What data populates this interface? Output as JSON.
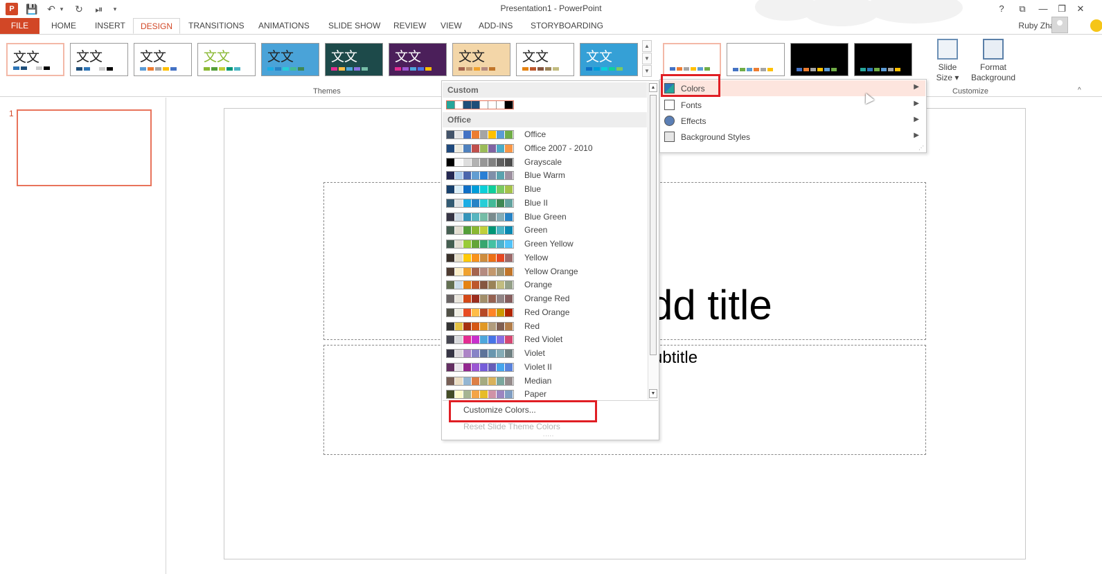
{
  "window": {
    "title": "Presentation1 - PowerPoint",
    "help": "?",
    "ribbon_display": "⧉",
    "minimize": "—",
    "restore": "❐",
    "close": "✕"
  },
  "qat": {
    "app_icon": "P",
    "save": "💾",
    "undo": "↶",
    "undo_more": "▾",
    "redo": "↻",
    "present": "⏯",
    "customize": "▾"
  },
  "tabs": {
    "file": "FILE",
    "home": "HOME",
    "insert": "INSERT",
    "design": "DESIGN",
    "transitions": "TRANSITIONS",
    "animations": "ANIMATIONS",
    "slideshow": "SLIDE SHOW",
    "review": "REVIEW",
    "view": "VIEW",
    "addins": "ADD-INS",
    "storyboarding": "STORYBOARDING"
  },
  "user": {
    "name": "Ruby Zhao",
    "menu_caret": "▾"
  },
  "ribbon": {
    "themes_glyph": "文文",
    "themes_label": "Themes",
    "customize_label": "Customize",
    "slide_size_1": "Slide",
    "slide_size_2": "Size ▾",
    "format_bg_1": "Format",
    "format_bg_2": "Background",
    "scroll_up": "▲",
    "scroll_down": "▼",
    "scroll_more": "▼"
  },
  "slides_pane": {
    "slide_number": "1"
  },
  "slide": {
    "title_placeholder": "Click to add title",
    "subtitle_placeholder": "Click to add subtitle"
  },
  "colors_menu": {
    "custom_header": "Custom",
    "office_header": "Office",
    "custom_swatch": [
      "#26a69a",
      "#ffffff",
      "#1f4e79",
      "#1f4e79",
      "#ffffff",
      "#ffffff",
      "#ffffff",
      "#000000"
    ],
    "palettes": [
      {
        "name": "Office",
        "colors": [
          "#44546a",
          "#e7e6e6",
          "#4472c4",
          "#ed7d31",
          "#a5a5a5",
          "#ffc000",
          "#5b9bd5",
          "#70ad47"
        ]
      },
      {
        "name": "Office 2007 - 2010",
        "colors": [
          "#1f497d",
          "#eeece1",
          "#4f81bd",
          "#c0504d",
          "#9bbb59",
          "#8064a2",
          "#4bacc6",
          "#f79646"
        ]
      },
      {
        "name": "Grayscale",
        "colors": [
          "#000000",
          "#f8f8f8",
          "#dddddd",
          "#b2b2b2",
          "#969696",
          "#808080",
          "#5f5f5f",
          "#4d4d4d"
        ]
      },
      {
        "name": "Blue Warm",
        "colors": [
          "#242852",
          "#acccea",
          "#4a66ac",
          "#629dd1",
          "#297fd5",
          "#7f8fa9",
          "#5aa2ae",
          "#9d90a0"
        ]
      },
      {
        "name": "Blue",
        "colors": [
          "#17406d",
          "#dbeff9",
          "#0f6fc6",
          "#009dd9",
          "#0bd0d9",
          "#10cf9b",
          "#7cca62",
          "#a5c249"
        ]
      },
      {
        "name": "Blue II",
        "colors": [
          "#335b74",
          "#dfe3e5",
          "#1cade4",
          "#2683c6",
          "#27ced7",
          "#42ba97",
          "#3e8853",
          "#62a39f"
        ]
      },
      {
        "name": "Blue Green",
        "colors": [
          "#373545",
          "#cedbe6",
          "#3494ba",
          "#58b6c0",
          "#75bda7",
          "#7a8c8e",
          "#84acb6",
          "#2683c6"
        ]
      },
      {
        "name": "Green",
        "colors": [
          "#455f51",
          "#e3ded1",
          "#549e39",
          "#8ab833",
          "#c0cf3a",
          "#029676",
          "#4ab5c4",
          "#0989b1"
        ]
      },
      {
        "name": "Green Yellow",
        "colors": [
          "#455f51",
          "#e3ded1",
          "#99cb38",
          "#63a537",
          "#37a76f",
          "#44c1a3",
          "#4eb3cf",
          "#51c3f9"
        ]
      },
      {
        "name": "Yellow",
        "colors": [
          "#39302a",
          "#e5dec9",
          "#ffca08",
          "#f8931d",
          "#ce8d3e",
          "#ec7016",
          "#e64823",
          "#9c6a6a"
        ]
      },
      {
        "name": "Yellow Orange",
        "colors": [
          "#4e3b30",
          "#fbeec9",
          "#f0a22e",
          "#a5644e",
          "#b58b80",
          "#c3986d",
          "#a19574",
          "#c17529"
        ]
      },
      {
        "name": "Orange",
        "colors": [
          "#637052",
          "#ccddea",
          "#e48312",
          "#bd582c",
          "#865640",
          "#9b8357",
          "#c2bc80",
          "#94a088"
        ]
      },
      {
        "name": "Orange Red",
        "colors": [
          "#696464",
          "#e9e5dc",
          "#d34817",
          "#9b2d1f",
          "#a28e6a",
          "#956251",
          "#918485",
          "#855d5d"
        ]
      },
      {
        "name": "Red Orange",
        "colors": [
          "#505046",
          "#eeece1",
          "#e84c22",
          "#ffbd47",
          "#b64926",
          "#ff8427",
          "#cc9900",
          "#b22600"
        ]
      },
      {
        "name": "Red",
        "colors": [
          "#323232",
          "#e5c243",
          "#a5300f",
          "#d55816",
          "#e19825",
          "#b19c7d",
          "#7f5f52",
          "#b27d49"
        ]
      },
      {
        "name": "Red Violet",
        "colors": [
          "#454551",
          "#d8d9dc",
          "#e32d91",
          "#c830cc",
          "#4ea6dc",
          "#4775e7",
          "#8971e1",
          "#d54773"
        ]
      },
      {
        "name": "Violet",
        "colors": [
          "#373545",
          "#dcd8dc",
          "#ad84c6",
          "#8784c7",
          "#5d739a",
          "#6997af",
          "#84acb6",
          "#6f8183"
        ]
      },
      {
        "name": "Violet II",
        "colors": [
          "#632e62",
          "#eae5eb",
          "#92278f",
          "#9b57d3",
          "#755dd9",
          "#665eb8",
          "#45a5ed",
          "#5982db"
        ]
      },
      {
        "name": "Median",
        "colors": [
          "#775f55",
          "#ebddc3",
          "#94b6d2",
          "#dd8047",
          "#a5ab81",
          "#d8b25c",
          "#7ba79d",
          "#968c8c"
        ]
      },
      {
        "name": "Paper",
        "colors": [
          "#444d26",
          "#fefac9",
          "#a5b592",
          "#f3a447",
          "#e7bc29",
          "#d092a7",
          "#9c85c0",
          "#809ec2"
        ]
      }
    ],
    "customize_colors": "Customize Colors...",
    "reset_colors": "Reset Slide Theme Colors",
    "scroll_up": "▲",
    "scroll_down": "▼",
    "grip": "....."
  },
  "variants_menu": {
    "items": [
      {
        "label": "Colors",
        "arrow": "▶"
      },
      {
        "label": "Fonts",
        "arrow": "▶"
      },
      {
        "label": "Effects",
        "arrow": "▶"
      },
      {
        "label": "Background Styles",
        "arrow": "▶"
      }
    ],
    "grip": "⋰"
  },
  "themes": [
    {
      "bg": "#ffffff",
      "text": "#222222",
      "bars": [
        "#2e75b6",
        "#1f4e79",
        "#ffffff",
        "#cccccc",
        "#000000"
      ]
    },
    {
      "bg": "#ffffff",
      "text": "#222222",
      "bars": [
        "#1f4e79",
        "#2e75b6",
        "#ffffff",
        "#cccccc",
        "#000000"
      ]
    },
    {
      "bg": "#ffffff",
      "text": "#222222",
      "bars": [
        "#5b9bd5",
        "#ed7d31",
        "#a5a5a5",
        "#ffc000",
        "#4472c4"
      ]
    },
    {
      "bg": "#ffffff",
      "text": "#8ab833",
      "bars": [
        "#8ab833",
        "#549e39",
        "#c0cf3a",
        "#029676",
        "#4ab5c4"
      ]
    },
    {
      "bg": "#4aa3d8",
      "text": "#222222",
      "bars": [
        "#1cade4",
        "#2683c6",
        "#27ced7",
        "#42ba97",
        "#3e8853"
      ]
    },
    {
      "bg": "#1d4a4a",
      "text": "#ffffff",
      "bars": [
        "#e32d91",
        "#ffbd47",
        "#4ea6dc",
        "#8971e1",
        "#75bda7"
      ]
    },
    {
      "bg": "#4b1f5a",
      "text": "#ffffff",
      "bars": [
        "#e32d91",
        "#9b57d3",
        "#4ea6dc",
        "#4775e7",
        "#ffc000"
      ]
    },
    {
      "bg": "#f3d6a8",
      "text": "#222222",
      "bars": [
        "#a5644e",
        "#c3986d",
        "#f0a22e",
        "#b58b80",
        "#c17529"
      ]
    },
    {
      "bg": "#ffffff",
      "text": "#222222",
      "bars": [
        "#e48312",
        "#bd582c",
        "#865640",
        "#9b8357",
        "#c2bc80"
      ]
    },
    {
      "bg": "#35a0d6",
      "text": "#ffffff",
      "bars": [
        "#0f6fc6",
        "#009dd9",
        "#0bd0d9",
        "#10cf9b",
        "#7cca62"
      ]
    }
  ],
  "variants": [
    {
      "bg": "#ffffff",
      "bars": [
        "#4472c4",
        "#ed7d31",
        "#a5a5a5",
        "#ffc000",
        "#5b9bd5",
        "#70ad47"
      ]
    },
    {
      "bg": "#ffffff",
      "bars": [
        "#4472c4",
        "#70ad47",
        "#5b9bd5",
        "#ed7d31",
        "#a5a5a5",
        "#ffc000"
      ]
    },
    {
      "bg": "#000000",
      "bars": [
        "#4472c4",
        "#ed7d31",
        "#a5a5a5",
        "#ffc000",
        "#5b9bd5",
        "#70ad47"
      ]
    },
    {
      "bg": "#000000",
      "bars": [
        "#26a69a",
        "#2e75b6",
        "#70ad47",
        "#5b9bd5",
        "#a5a5a5",
        "#ffc000"
      ]
    }
  ]
}
